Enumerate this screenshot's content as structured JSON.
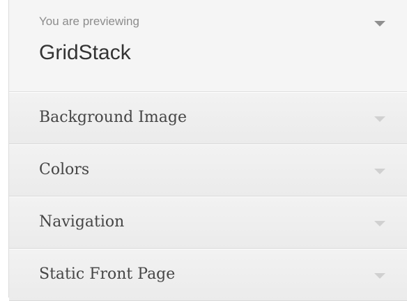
{
  "preview": {
    "label": "You are previewing",
    "theme_name": "GridStack",
    "toggle_icon": "chevron-down-icon"
  },
  "sections": [
    {
      "label": "Background Image",
      "icon": "chevron-down-icon"
    },
    {
      "label": "Colors",
      "icon": "chevron-down-icon"
    },
    {
      "label": "Navigation",
      "icon": "chevron-down-icon"
    },
    {
      "label": "Static Front Page",
      "icon": "chevron-down-icon"
    }
  ],
  "colors": {
    "panel_bg": "#f5f5f5",
    "title_text": "#333333",
    "label_text": "#8c8c8c",
    "section_text": "#454545",
    "arrow_dark": "#8f8f8f",
    "arrow_light": "#d0d0d0"
  }
}
